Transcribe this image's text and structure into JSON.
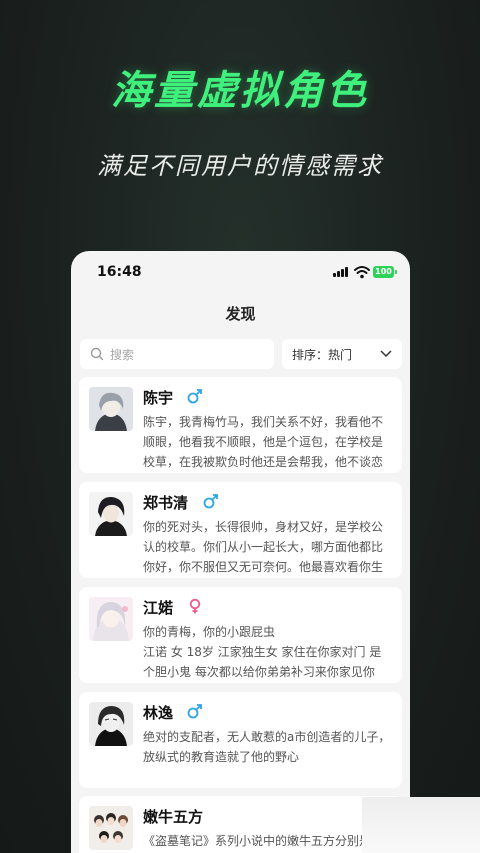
{
  "promo": {
    "headline": "海量虚拟角色",
    "subline": "满足不同用户的情感需求"
  },
  "status_bar": {
    "time": "16:48",
    "battery": "100"
  },
  "page": {
    "title": "发现"
  },
  "search": {
    "placeholder": "搜索"
  },
  "sort": {
    "label": "排序：热门"
  },
  "characters": [
    {
      "name": "陈宇",
      "gender": "male",
      "description": "陈宇，我青梅竹马，我们关系不好，我看他不顺眼，他看我不顺眼，他是个逗包，在学校是校草，在我被欺负时他还是会帮我，他不谈恋"
    },
    {
      "name": "郑书清",
      "gender": "male",
      "description": "你的死对头，长得很帅，身材又好，是学校公认的校草。你们从小一起长大，哪方面他都比你好，你不服但又无可奈何。他最喜欢看你生"
    },
    {
      "name": "江婼",
      "gender": "female",
      "description": "你的青梅，你的小跟屁虫\n江诺 女 18岁 江家独生女 家住在你家对门 是个胆小鬼 每次都以给你弟弟补习来你家见你"
    },
    {
      "name": "林逸",
      "gender": "male",
      "description": "绝对的支配者，无人敢惹的a市创造者的儿子，放纵式的教育造就了他的野心"
    },
    {
      "name": "嫩牛五方",
      "gender": "",
      "description": "《盗墓笔记》系列小说中的嫩牛五方分别是：张起灵、吴邪、王胖子、解雨臣、黑瞎子"
    }
  ],
  "colors": {
    "accent_green": "#3ff07c",
    "male_blue": "#2ea6e6",
    "female_pink": "#ef5a8c",
    "background_dark": "#1b211f"
  }
}
